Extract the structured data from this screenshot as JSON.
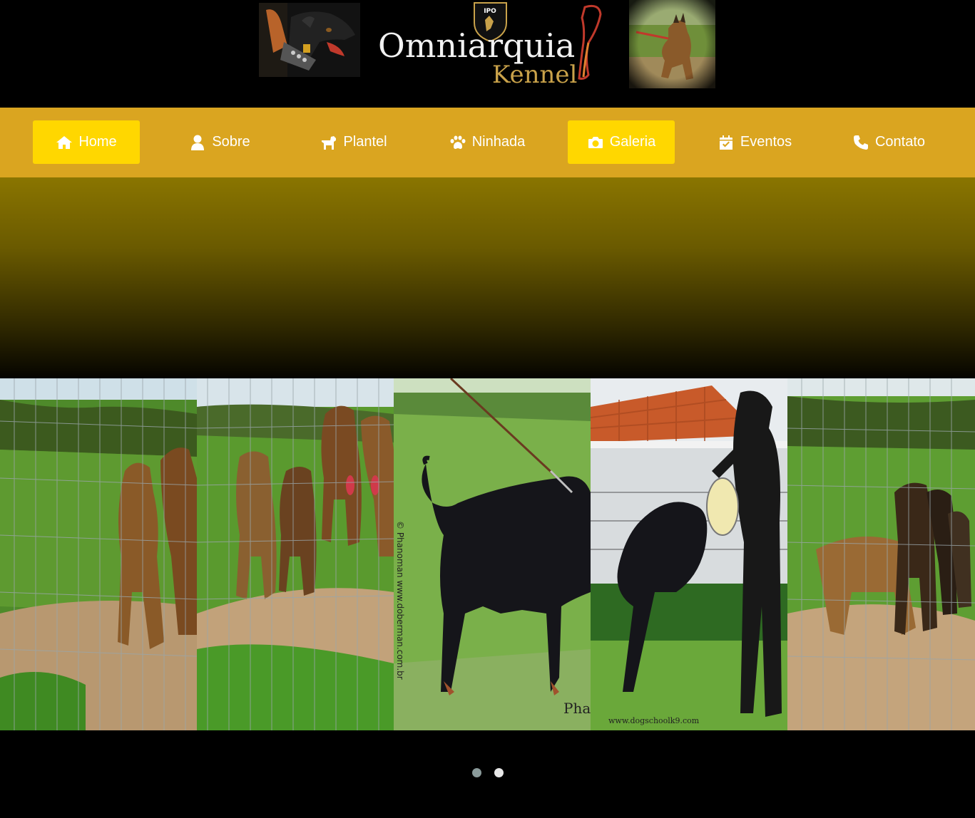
{
  "header": {
    "logo_text": "Omniarquia",
    "logo_subtext": "Kennel",
    "badge_text": "IPO"
  },
  "nav": {
    "items": [
      {
        "label": "Home",
        "icon": "home-icon",
        "active": true
      },
      {
        "label": "Sobre",
        "icon": "user-icon",
        "active": false
      },
      {
        "label": "Plantel",
        "icon": "dog-icon",
        "active": false
      },
      {
        "label": "Ninhada",
        "icon": "paw-icon",
        "active": false
      },
      {
        "label": "Galeria",
        "icon": "camera-icon",
        "active": true
      },
      {
        "label": "Eventos",
        "icon": "calendar-check-icon",
        "active": false
      },
      {
        "label": "Contato",
        "icon": "phone-icon",
        "active": false
      }
    ]
  },
  "carousel": {
    "slides": [
      {
        "name": "puppies-behind-fence-1"
      },
      {
        "name": "puppies-behind-fence-2",
        "watermark": "© Phanoman"
      },
      {
        "name": "doberman-standing",
        "watermark": "© Phanoman   www.doberman.com.br",
        "corner": "Phan"
      },
      {
        "name": "doberman-bite-training",
        "watermark": "www.dogschoolk9.com"
      },
      {
        "name": "puppies-behind-fence-3"
      }
    ],
    "dots": [
      {
        "state": "inactive"
      },
      {
        "state": "active"
      }
    ]
  },
  "colors": {
    "nav_bg": "#daa520",
    "nav_active": "#ffd700",
    "page_bg": "#000000",
    "logo_gold": "#c9a24a"
  }
}
